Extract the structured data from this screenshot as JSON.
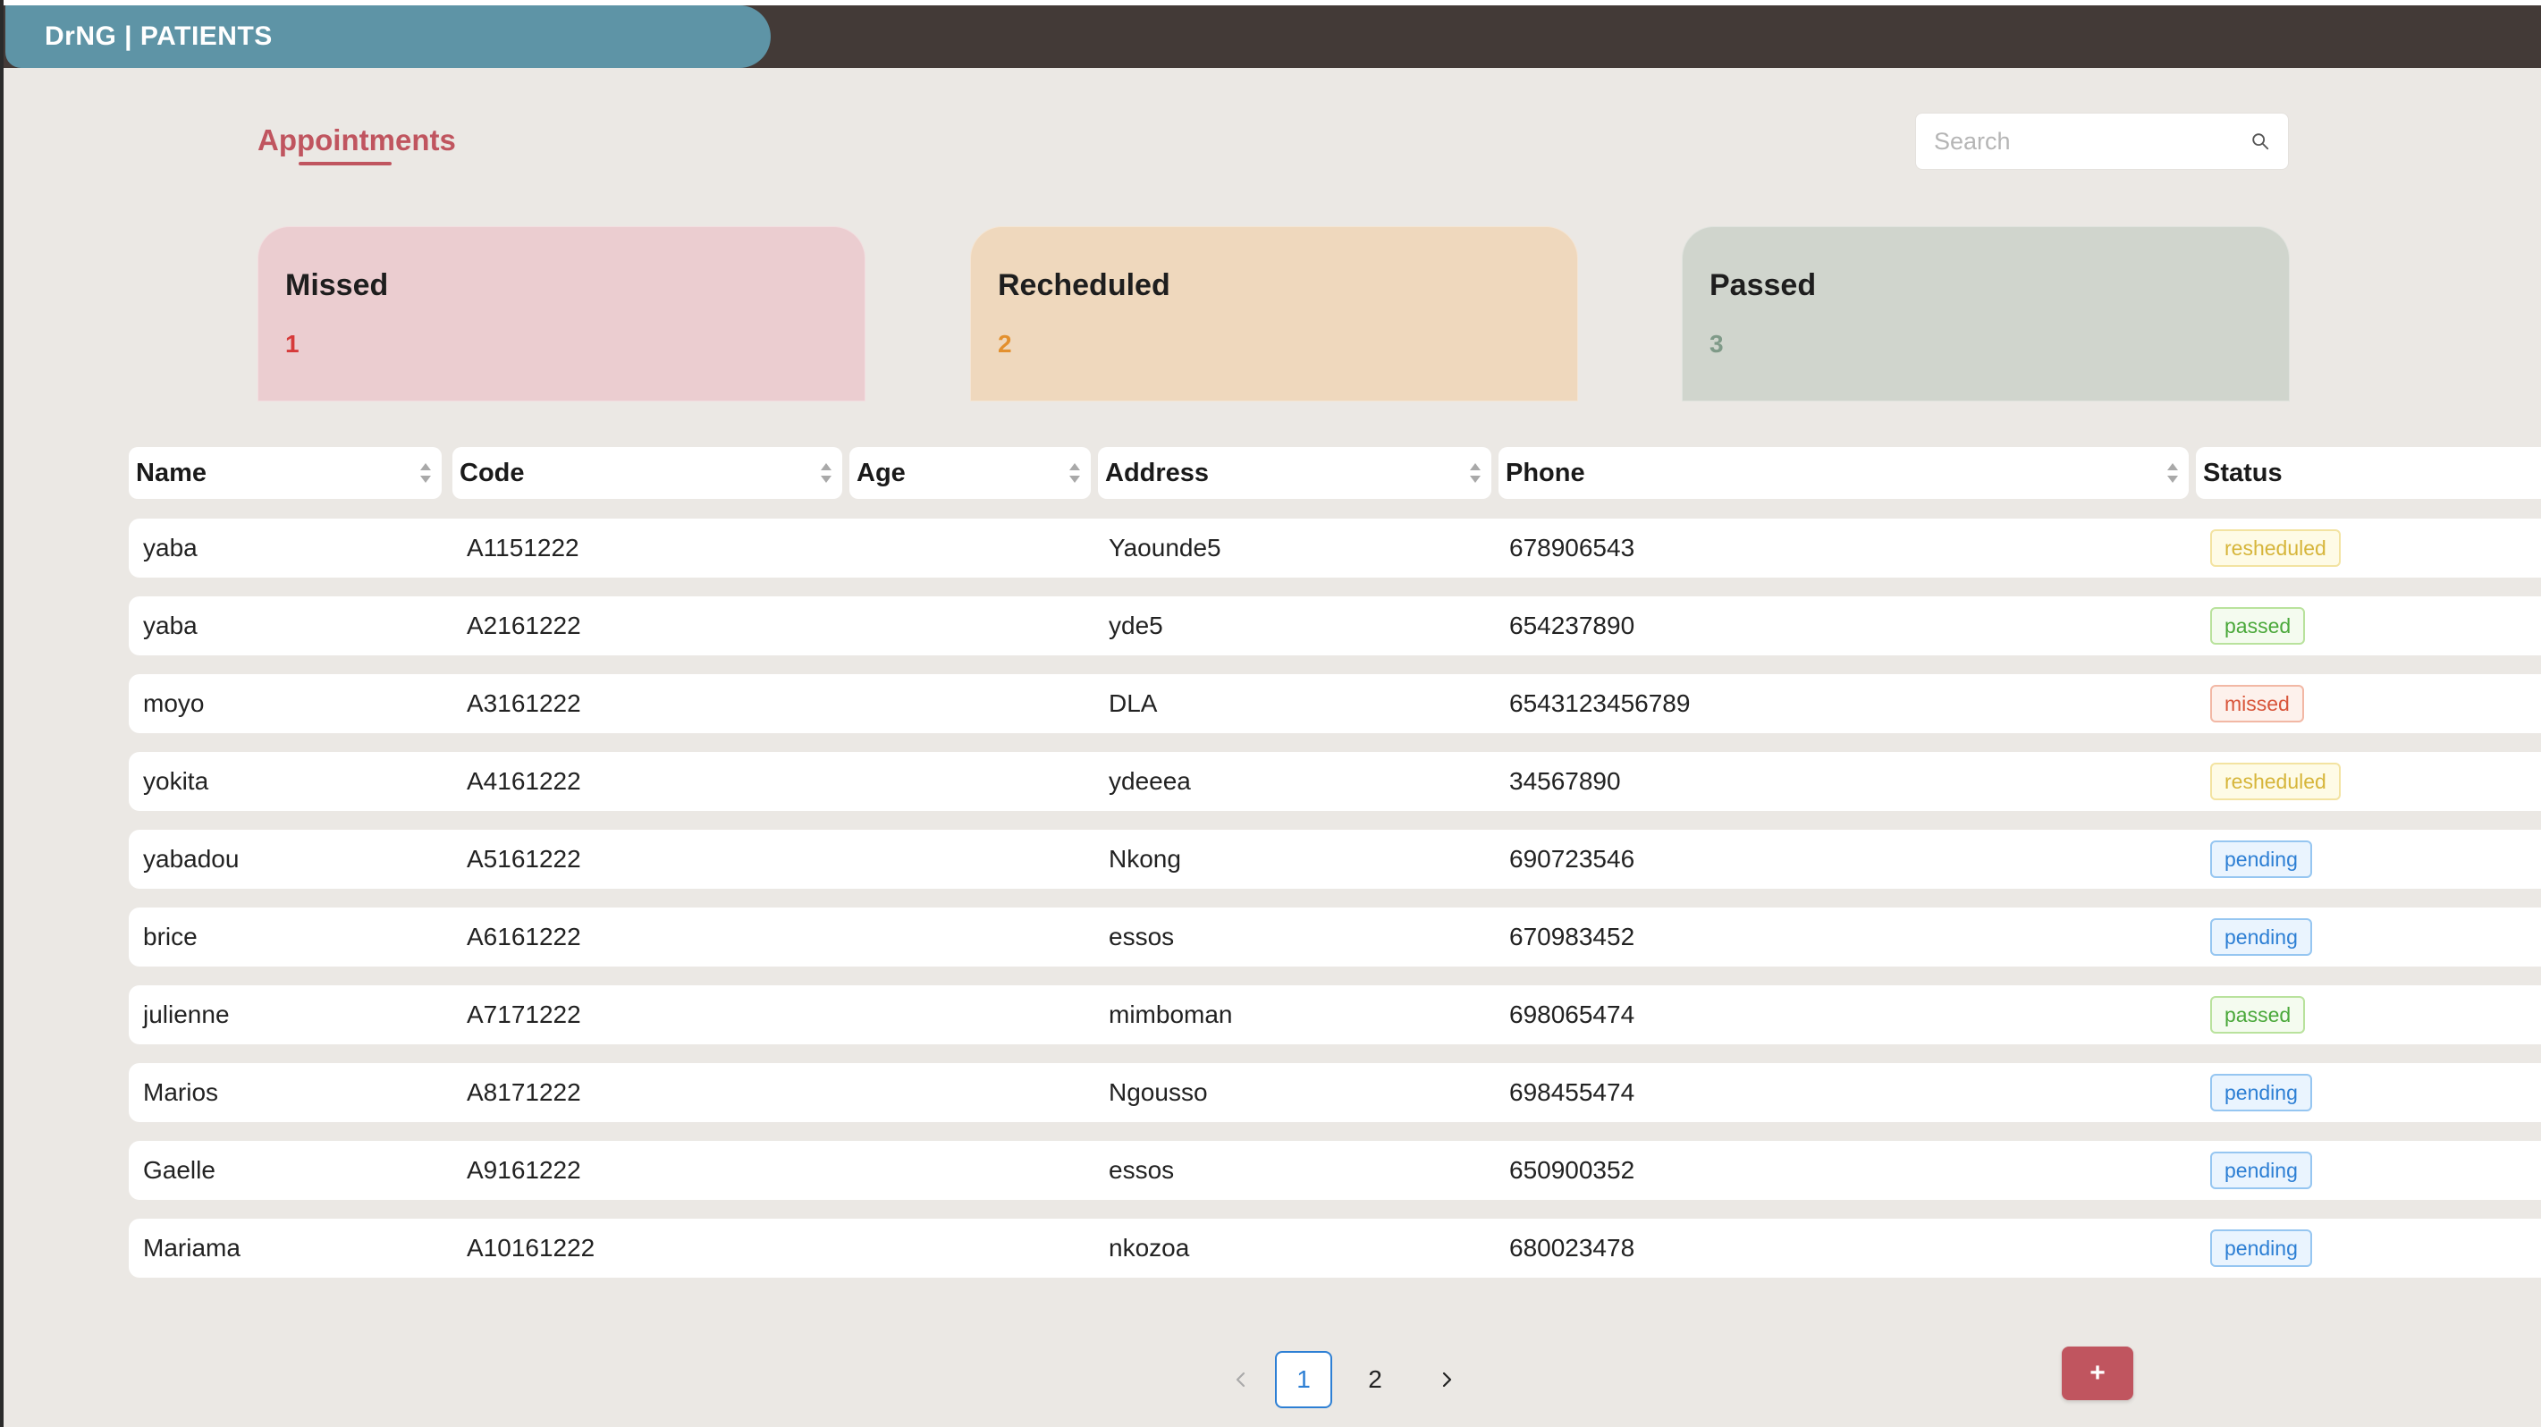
{
  "app": {
    "brand": "DrNG | PATIENTS"
  },
  "page": {
    "title": "Appointments"
  },
  "search": {
    "placeholder": "Search",
    "value": ""
  },
  "cards": [
    {
      "title": "Missed",
      "count": "1",
      "color": "#d63a3a"
    },
    {
      "title": "Recheduled",
      "count": "2",
      "color": "#e3902e"
    },
    {
      "title": "Passed",
      "count": "3",
      "color": "#7f9a88"
    }
  ],
  "table": {
    "columns": [
      "Name",
      "Code",
      "Age",
      "Address",
      "Phone",
      "Status"
    ],
    "rows": [
      {
        "name": "yaba",
        "code": "A1151222",
        "age": "",
        "address": "Yaounde5",
        "phone": "678906543",
        "status": "resheduled"
      },
      {
        "name": "yaba",
        "code": "A2161222",
        "age": "",
        "address": "yde5",
        "phone": "654237890",
        "status": "passed"
      },
      {
        "name": "moyo",
        "code": "A3161222",
        "age": "",
        "address": "DLA",
        "phone": "6543123456789",
        "status": "missed"
      },
      {
        "name": "yokita",
        "code": "A4161222",
        "age": "",
        "address": "ydeeea",
        "phone": "34567890",
        "status": "resheduled"
      },
      {
        "name": "yabadou",
        "code": "A5161222",
        "age": "",
        "address": "Nkong",
        "phone": "690723546",
        "status": "pending"
      },
      {
        "name": "brice",
        "code": "A6161222",
        "age": "",
        "address": "essos",
        "phone": "670983452",
        "status": "pending"
      },
      {
        "name": "julienne",
        "code": "A7171222",
        "age": "",
        "address": "mimboman",
        "phone": "698065474",
        "status": "passed"
      },
      {
        "name": "Marios",
        "code": "A8171222",
        "age": "",
        "address": "Ngousso",
        "phone": "698455474",
        "status": "pending"
      },
      {
        "name": "Gaelle",
        "code": "A9161222",
        "age": "",
        "address": "essos",
        "phone": "650900352",
        "status": "pending"
      },
      {
        "name": "Mariama",
        "code": "A10161222",
        "age": "",
        "address": "nkozoa",
        "phone": "680023478",
        "status": "pending"
      }
    ]
  },
  "pagination": {
    "pages": [
      "1",
      "2"
    ],
    "current": "1"
  },
  "actions": {
    "add_label": "+"
  },
  "colors": {
    "accent": "#c0555f",
    "header": "#433a37",
    "brand_bg": "#5e94a6",
    "link": "#2d7fd4"
  }
}
